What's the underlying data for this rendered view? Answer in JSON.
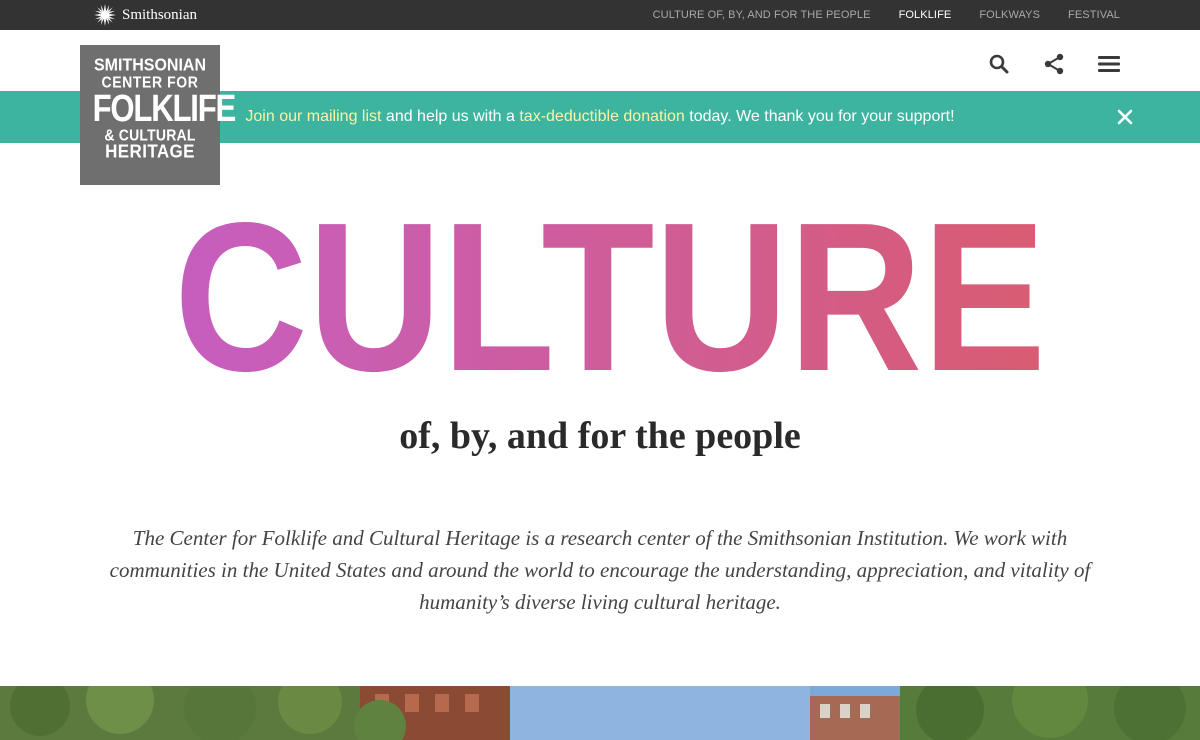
{
  "topbar": {
    "brand": "Smithsonian",
    "brand_icon": "sunburst-icon",
    "nav": [
      {
        "label": "CULTURE OF, BY, AND FOR THE PEOPLE",
        "active": false
      },
      {
        "label": "FOLKLIFE",
        "active": true
      },
      {
        "label": "FOLKWAYS",
        "active": false
      },
      {
        "label": "FESTIVAL",
        "active": false
      }
    ]
  },
  "logo": {
    "line1": "SMITHSONIAN",
    "line2": "CENTER FOR",
    "line3": "FOLKLIFE",
    "line4": "& CULTURAL",
    "line5": "HERITAGE"
  },
  "header": {
    "icons": [
      "search-icon",
      "share-icon",
      "menu-icon"
    ]
  },
  "banner": {
    "link1": "Join our mailing list",
    "text1": " and help us with a ",
    "link2": "tax-deductible donation",
    "text2": " today. We thank you for your support!",
    "close_icon": "close-icon"
  },
  "hero": {
    "headline": "CULTURE",
    "subtitle": "of, by, and for the people",
    "intro": "The Center for Folklife and Cultural Heritage is a research center of the Smithsonian Institution. We work with communities in the United States and around the world to encourage the understanding, appreciation, and vitality of humanity’s diverse living cultural heritage."
  },
  "colors": {
    "topbar_bg": "#333333",
    "banner_bg": "#3cb4a0",
    "banner_link": "#fcf3a6",
    "logo_bg": "#6f6f6f",
    "headline_gradient_start": "#c65ec0",
    "headline_gradient_end": "#d85c72"
  }
}
